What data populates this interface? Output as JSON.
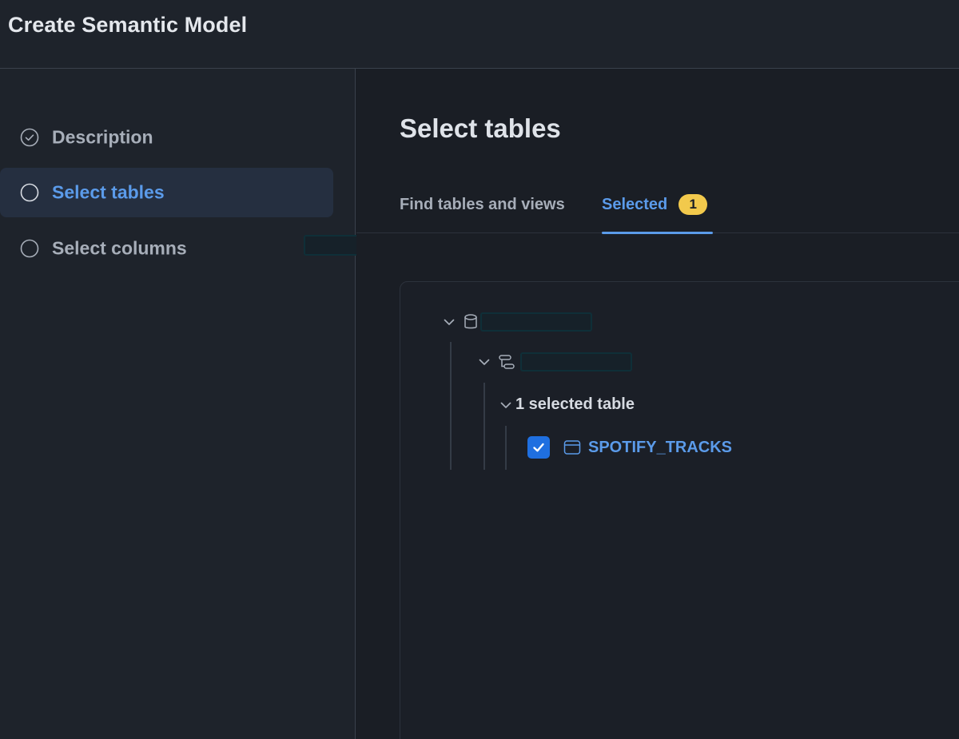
{
  "header": {
    "title": "Create Semantic Model"
  },
  "sidebar": {
    "steps": [
      {
        "label": "Description",
        "icon": "check-circle-icon",
        "state": "done"
      },
      {
        "label": "Select tables",
        "icon": "circle-icon",
        "state": "active"
      },
      {
        "label": "Select columns",
        "icon": "circle-icon",
        "state": "pending"
      }
    ]
  },
  "main": {
    "title": "Select tables",
    "tabs": [
      {
        "label": "Find tables and views"
      },
      {
        "label": "Selected",
        "badge": "1"
      }
    ],
    "tree": {
      "database_icon": "database-icon",
      "schema_icon": "schema-icon",
      "group_label": "1 selected table",
      "table": {
        "name": "SPOTIFY_TRACKS",
        "checked": true,
        "icon": "table-icon"
      }
    }
  },
  "colors": {
    "accent": "#5b9bea",
    "badge": "#f2c94c",
    "checkbox": "#1f6fe0",
    "background": "#1a1e25",
    "sidebar": "#1e232b"
  }
}
